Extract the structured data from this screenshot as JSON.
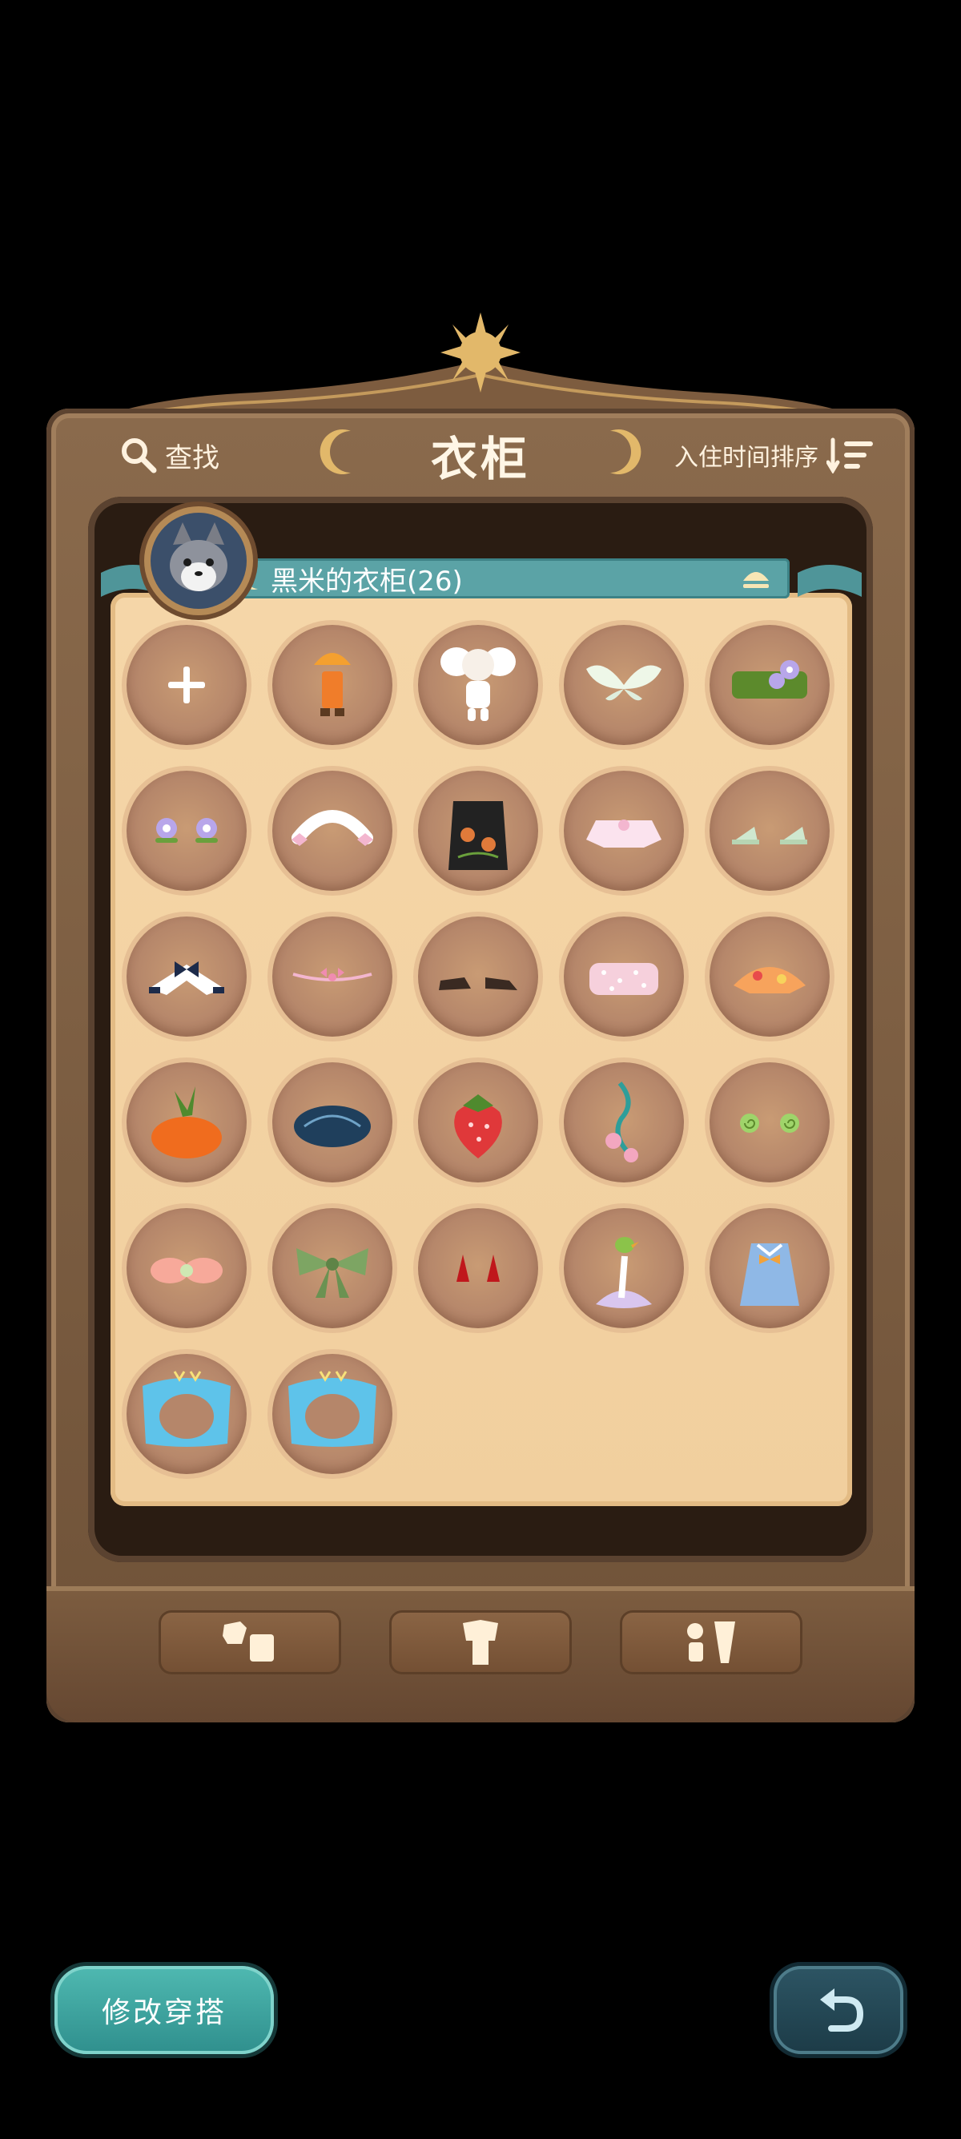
{
  "header": {
    "search_label": "查找",
    "title": "衣柜",
    "sort_label": "入住时间排序"
  },
  "banner": {
    "label": "黑米的衣柜(26)"
  },
  "items": [
    {
      "name": "add-slot"
    },
    {
      "name": "orange-umbrella-outfit"
    },
    {
      "name": "white-elephant-costume"
    },
    {
      "name": "white-wings"
    },
    {
      "name": "green-flower-belt"
    },
    {
      "name": "purple-flower-clips"
    },
    {
      "name": "white-bow-headband"
    },
    {
      "name": "black-pumpkin-apron"
    },
    {
      "name": "pink-ribbon-top"
    },
    {
      "name": "mint-shoes"
    },
    {
      "name": "navy-bow-collar"
    },
    {
      "name": "pink-bead-necklace"
    },
    {
      "name": "brown-shoes"
    },
    {
      "name": "pink-polka-top"
    },
    {
      "name": "floral-scarf"
    },
    {
      "name": "carrot-hat"
    },
    {
      "name": "navy-beret"
    },
    {
      "name": "strawberry-hat"
    },
    {
      "name": "teal-flower-charm"
    },
    {
      "name": "green-snail-clips"
    },
    {
      "name": "peach-fluffy-accessory"
    },
    {
      "name": "green-ribbon-bow"
    },
    {
      "name": "red-horns"
    },
    {
      "name": "bird-flower-hat"
    },
    {
      "name": "blue-bow-dress"
    },
    {
      "name": "blue-butterfly-frame-1"
    },
    {
      "name": "blue-butterfly-frame-2"
    }
  ],
  "bottom_tabs": [
    {
      "icon": "top-bottom-clothing-icon"
    },
    {
      "icon": "outfit-icon"
    },
    {
      "icon": "accessory-icon"
    }
  ],
  "buttons": {
    "edit_outfit": "修改穿搭"
  },
  "colors": {
    "frame": "#7a5a3e",
    "panel": "#f3d3a3",
    "banner": "#5ba3a6",
    "edit_button": "#3aa39e",
    "back_button": "#24495a"
  }
}
